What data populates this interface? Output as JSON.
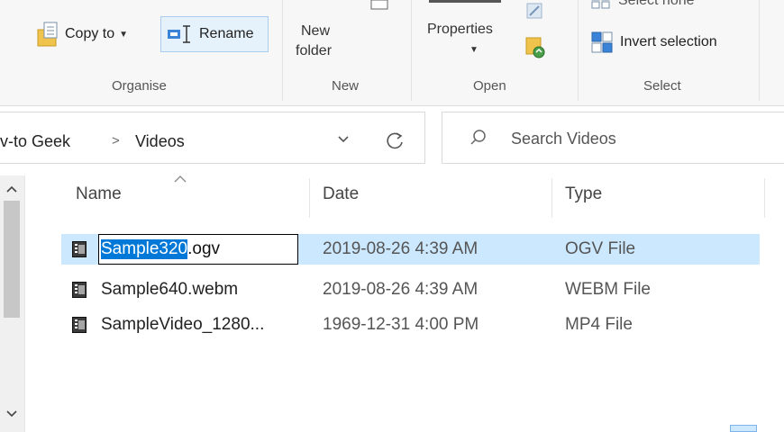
{
  "ribbon": {
    "copy_to": "Copy to",
    "rename": "Rename",
    "new_folder": "New\nfolder",
    "new_folder_line1": "New",
    "new_folder_line2": "folder",
    "properties": "Properties",
    "select_none": "Select none",
    "invert_selection": "Invert selection",
    "groups": {
      "organise": "Organise",
      "new": "New",
      "open": "Open",
      "select": "Select"
    }
  },
  "address": {
    "crumb_parent": "v-to Geek",
    "separator": ">",
    "crumb_current": "Videos"
  },
  "search": {
    "placeholder": "Search Videos"
  },
  "columns": {
    "name": "Name",
    "date": "Date",
    "type": "Type"
  },
  "files": [
    {
      "name": "Sample320.ogv",
      "name_selected_part": "Sample320",
      "name_rest": ".ogv",
      "date": "2019-08-26 4:39 AM",
      "type": "OGV File"
    },
    {
      "name": "Sample640.webm",
      "date": "2019-08-26 4:39 AM",
      "type": "WEBM File"
    },
    {
      "name": "SampleVideo_1280...",
      "date": "1969-12-31 4:00 PM",
      "type": "MP4 File"
    }
  ],
  "colors": {
    "selection_row": "#cce8ff",
    "text_selection": "#0078d7",
    "ribbon_bg": "#f7f7f7"
  }
}
